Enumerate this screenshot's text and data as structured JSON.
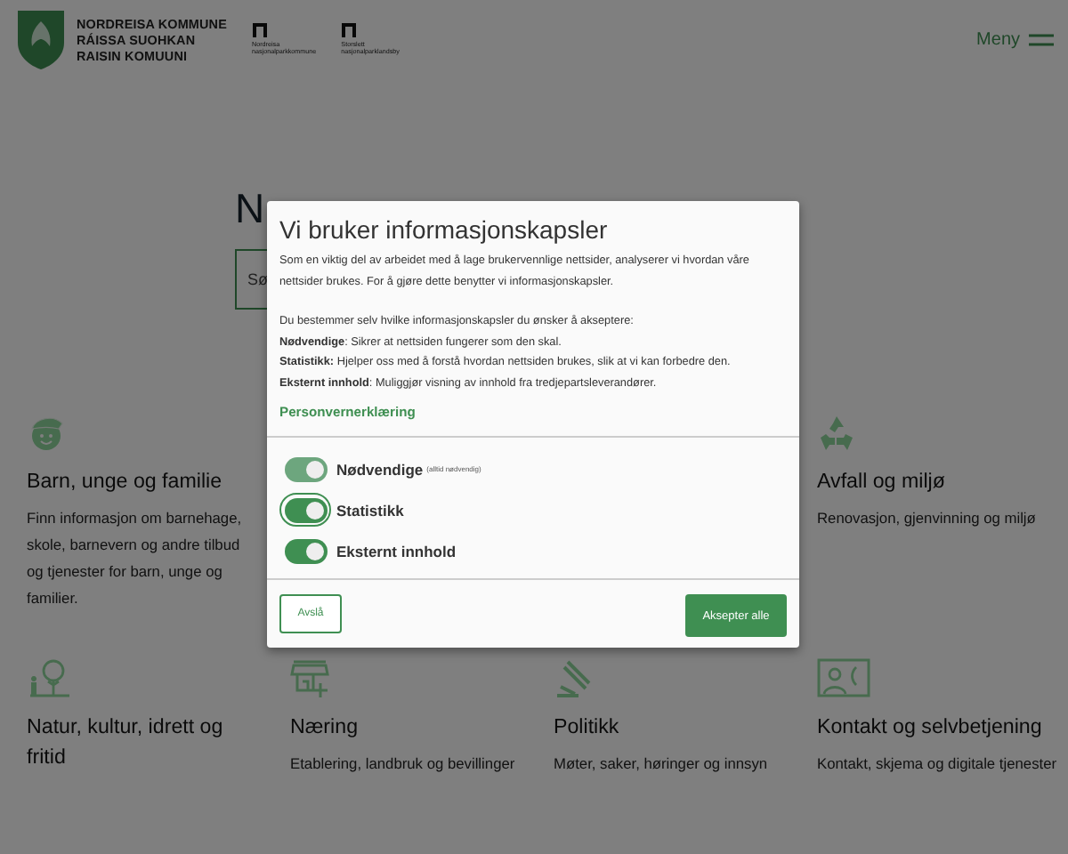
{
  "header": {
    "logo_lines": [
      "NORDREISA KOMMUNE",
      "RÁISSA SUOHKAN",
      "RAISIN KOMUUNI"
    ],
    "partner_logos": [
      {
        "lines": [
          "Nordreisa",
          "nasjonalparkkommune"
        ]
      },
      {
        "lines": [
          "Storslett",
          "nasjonalparklandsby"
        ]
      }
    ],
    "menu": {
      "label": "Meny"
    }
  },
  "heading": {
    "start": "N"
  },
  "search": {
    "placeholder": "Sø"
  },
  "categories": [
    {
      "title": "Barn, unge og familie",
      "description": "Finn informasjon om barnehage, skole, barnevern og andre tilbud og tjenester for barn, unge og familier."
    },
    {
      "title": "Avfall og miljø",
      "description": "Renovasjon, gjenvinning og miljø"
    },
    {
      "title": "Natur, kultur, idrett og fritid"
    },
    {
      "title": "Næring",
      "description": "Etablering, landbruk og bevillinger"
    },
    {
      "title": "Politikk",
      "description": "Møter, saker, høringer og innsyn"
    },
    {
      "title": "Kontakt og selvbetjening",
      "description": "Kontakt, skjema og digitale tjenester"
    }
  ],
  "cookie_dialog": {
    "title": "Vi bruker informasjonskapsler",
    "intro": "Som en viktig del av arbeidet med å lage brukervennlige nettsider, analyserer vi hvordan våre nettsider brukes. For å gjøre dette benytter vi informasjonskapsler.",
    "lead": "Du bestemmer selv hvilke informasjonskapsler du ønsker å akseptere:",
    "explanations": [
      "**Nødvendige**: Sikrer at nettsiden fungerer som den skal.",
      "**Statistikk:** Hjelper oss med å forstå hvordan nettsiden brukes, slik at vi kan forbedre den.",
      "**Eksternt innhold**: Muliggjør visning av innhold fra tredjepartsleverandører."
    ],
    "privacy_link": "Personvernerklæring",
    "toggles": [
      {
        "label": "Nødvendige",
        "note": "(alltid nødvendig)",
        "on": true,
        "disabled": true,
        "focused": false
      },
      {
        "label": "Statistikk",
        "on": true,
        "disabled": false,
        "focused": true
      },
      {
        "label": "Eksternt innhold",
        "on": true,
        "disabled": false,
        "focused": false
      }
    ],
    "decline_button": "Avslå",
    "accept_button": "Aksepter alle"
  }
}
